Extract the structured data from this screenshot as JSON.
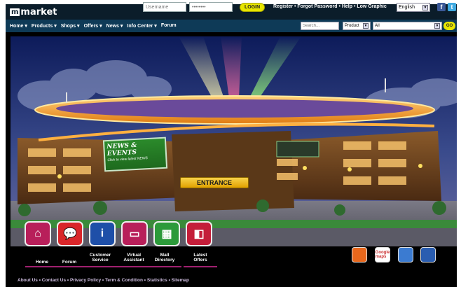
{
  "brand": {
    "logo_mark": "m",
    "logo_text": "market"
  },
  "login": {
    "username_placeholder": "Username",
    "password_placeholder": "••••••••",
    "login_label": "LOGIN"
  },
  "top_links": "Register • Forgot Password • Help • Low Graphic",
  "language": {
    "selected": "English"
  },
  "social": {
    "facebook": "f",
    "twitter": "t"
  },
  "nav": {
    "items": [
      "Home",
      "Products",
      "Shops",
      "Offers",
      "News",
      "Info Center",
      "Forum"
    ]
  },
  "search": {
    "placeholder": "Search...",
    "category_selected": "Product",
    "scope_selected": "All",
    "go_label": "GO"
  },
  "hero": {
    "news_sign_title": "NEWS & EVENTS",
    "news_sign_sub": "Click to view latest NEWS",
    "entrance_label": "ENTRANCE"
  },
  "bottom_nav": [
    {
      "label": "Home",
      "icon": "home-icon",
      "color": "#b81f5a"
    },
    {
      "label": "Forum",
      "icon": "chat-bubble-icon",
      "color": "#d9262a"
    },
    {
      "label": "Customer Service",
      "icon": "info-icon",
      "color": "#1e4fa8"
    },
    {
      "label": "Virtual Assistant",
      "icon": "monitor-icon",
      "color": "#b81f5a"
    },
    {
      "label": "Mall Directory",
      "icon": "map-icon",
      "color": "#2c9a3a"
    },
    {
      "label": "Latest Offers",
      "icon": "shopping-bag-icon",
      "color": "#c41e3a"
    }
  ],
  "right_tools": [
    {
      "icon": "blog-icon",
      "label": "",
      "color": "#e8671c"
    },
    {
      "icon": "google-maps-icon",
      "label": "Google maps",
      "color": "#ffffff"
    },
    {
      "icon": "camera-icon",
      "label": "",
      "color": "#3b7bd1"
    },
    {
      "icon": "globe-icon",
      "label": "",
      "color": "#2a5db0"
    }
  ],
  "footer": {
    "links": "About Us • Contact Us • Privacy Policy • Term & Condition • Statistics • Sitemap"
  },
  "colors": {
    "topbar": "#0b1d2a",
    "navbar": "#0e3a57",
    "accent": "#e8e600",
    "frame": "#000000"
  }
}
